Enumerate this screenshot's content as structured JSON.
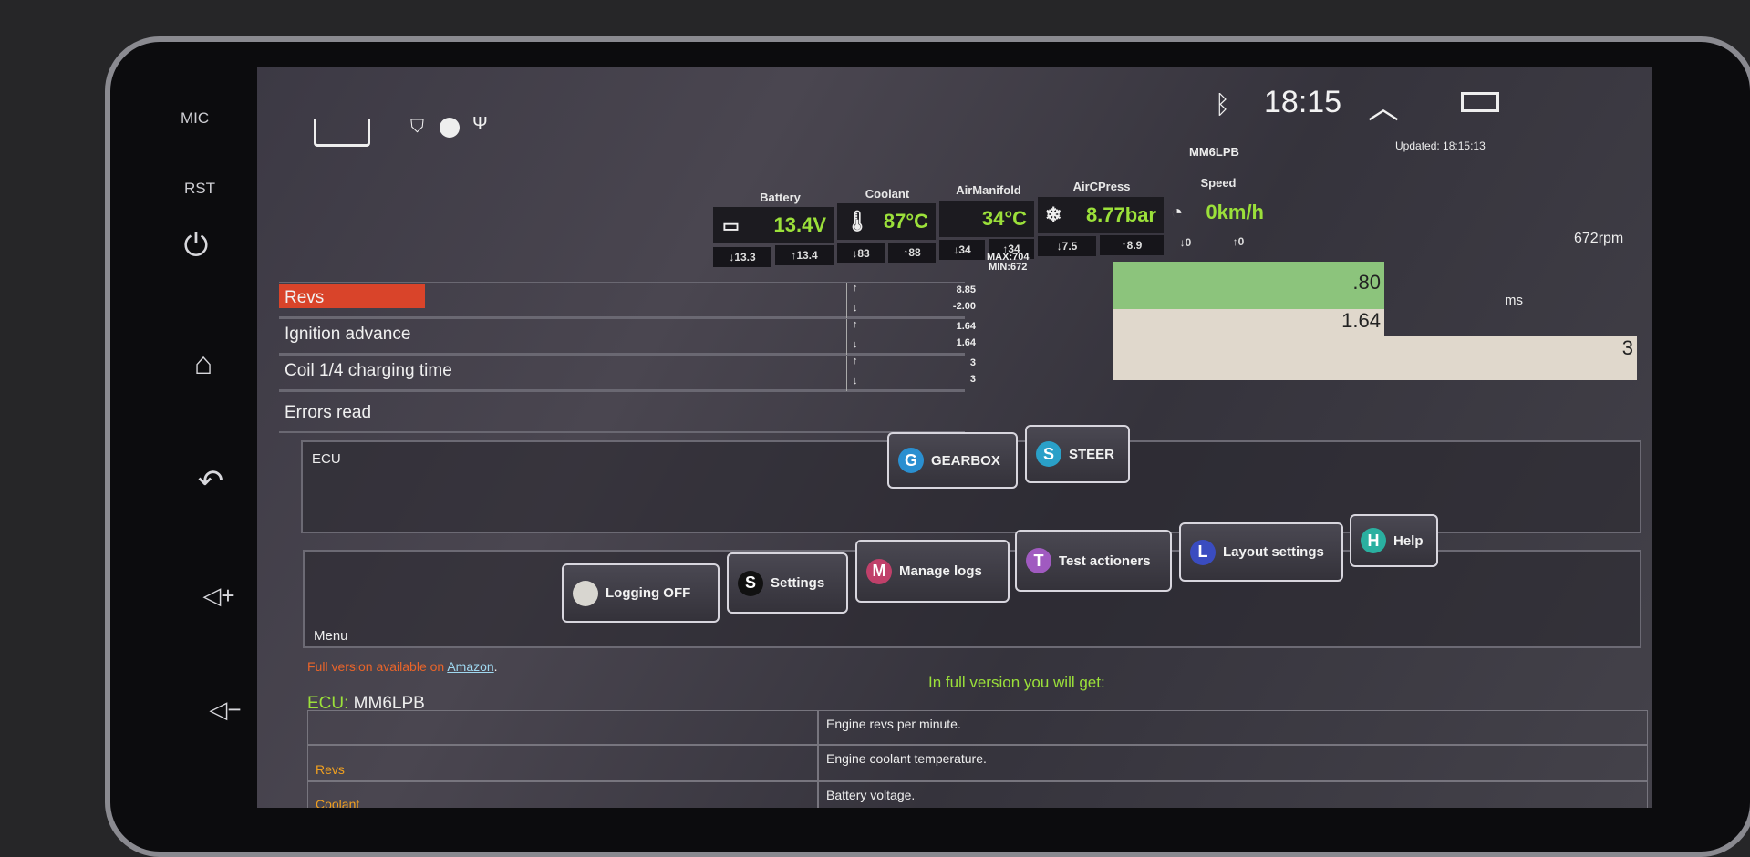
{
  "bezel": {
    "mic_label": "MIC",
    "rst_label": "RST"
  },
  "status_bar": {
    "time": "18:15",
    "icons": [
      "home-outline-icon",
      "shield-icon",
      "circle-icon",
      "usb-icon",
      "bluetooth-icon",
      "chevron-up-icon",
      "recents-icon"
    ]
  },
  "header": {
    "ecu_name": "MM6LPB",
    "updated": "Updated:  18:15:13",
    "rpm": "672rpm"
  },
  "gauges": [
    {
      "label": "Battery",
      "value": "13.4V",
      "min": "↓13.3",
      "max": "↑13.4",
      "icon": "battery-icon"
    },
    {
      "label": "Coolant",
      "value": "87°C",
      "min": "↓83",
      "max": "↑88",
      "icon": "thermometer-icon"
    },
    {
      "label": "AirManifold",
      "value": "34°C",
      "min": "↓34",
      "max": "↑34",
      "icon": ""
    },
    {
      "label": "AirCPress",
      "value": "8.77bar",
      "min": "↓7.5",
      "max": "↑8.9",
      "icon": "snowflake-icon"
    },
    {
      "label": "Speed",
      "value": "0km/h",
      "min": "↓0",
      "max": "↑0",
      "icon": "speedometer-icon"
    }
  ],
  "revs_range": {
    "max": "MAX:704",
    "min": "MIN:672"
  },
  "params": [
    {
      "label": "Revs",
      "up": "8.85",
      "down": "-2.00",
      "value": ".80"
    },
    {
      "label": "Ignition advance",
      "up": "1.64",
      "down": "1.64",
      "value": "1.64"
    },
    {
      "label": "Coil 1/4 charging time",
      "up": "3",
      "down": "3",
      "value": "3",
      "unit": "ms"
    },
    {
      "label": "Errors read"
    }
  ],
  "arrows": {
    "up": "↑",
    "down": "↓"
  },
  "ecu_panel": {
    "label": "ECU",
    "buttons": [
      {
        "letter": "G",
        "label": "GEARBOX",
        "color": "#2a8fd0"
      },
      {
        "letter": "S",
        "label": "STEER",
        "color": "#2aa0c8"
      }
    ]
  },
  "menu_panel": {
    "label": "Menu",
    "buttons": [
      {
        "letter": "",
        "label": "Logging OFF",
        "color": "#d8d6d0"
      },
      {
        "letter": "S",
        "label": "Settings",
        "color": "#111111"
      },
      {
        "letter": "M",
        "label": "Manage logs",
        "color": "#c0406a"
      },
      {
        "letter": "T",
        "label": "Test actioners",
        "color": "#a05ac0"
      },
      {
        "letter": "L",
        "label": "Layout settings",
        "color": "#3a4cc0"
      },
      {
        "letter": "H",
        "label": "Help",
        "color": "#2ab0a0"
      }
    ]
  },
  "promo": {
    "text": "Full version available on ",
    "link": "Amazon",
    "suffix": ".",
    "heading": "In full version you will get:",
    "ecu_prefix": "ECU:",
    "ecu_value": " MM6LPB"
  },
  "features": {
    "names": [
      "",
      "Revs",
      "Coolant"
    ],
    "descriptions": [
      "Engine revs per minute.",
      "Engine coolant temperature.",
      "Battery voltage."
    ]
  },
  "colors": {
    "accent_green": "#9be03a",
    "revs_red": "#d9442a",
    "promo_orange": "#e8642a",
    "bar_green": "#8cc47c",
    "bar_beige": "#e0d8cc"
  }
}
